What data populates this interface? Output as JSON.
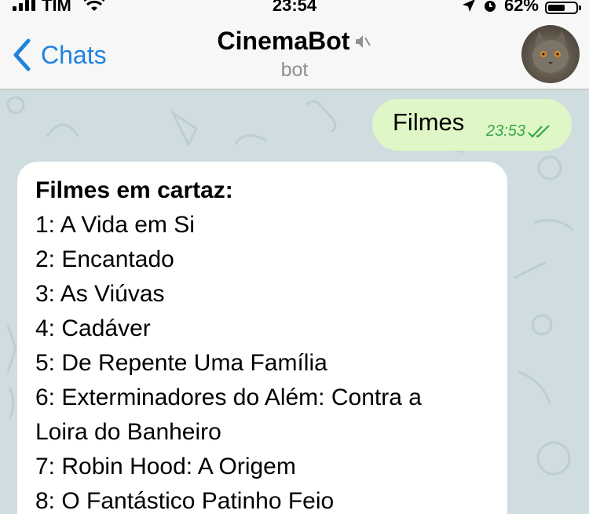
{
  "status_bar": {
    "carrier": "TIM",
    "time": "23:54",
    "battery_percent": "62%",
    "battery_level": 0.62
  },
  "header": {
    "back_label": "Chats",
    "title": "CinemaBot",
    "subtitle": "bot"
  },
  "messages": {
    "outgoing": {
      "text": "Filmes",
      "time": "23:53"
    },
    "incoming": {
      "heading": "Filmes em cartaz:",
      "lines": [
        "1: A Vida em Si",
        "2: Encantado",
        "3: As Viúvas",
        "4: Cadáver",
        "5: De Repente Uma Família",
        "6: Exterminadores do Além: Contra a",
        "Loira do Banheiro",
        "7: Robin Hood: A Origem",
        "8: O Fantástico Patinho Feio"
      ]
    }
  },
  "colors": {
    "accent": "#1f84e0",
    "chat_background": "#cfdde0",
    "outgoing_bubble": "#dff7c6",
    "read_check": "#3aa64a"
  }
}
